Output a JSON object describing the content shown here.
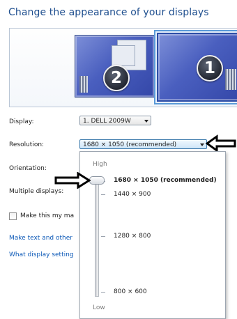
{
  "title": "Change the appearance of your displays",
  "monitors": [
    {
      "number": "2"
    },
    {
      "number": "1"
    }
  ],
  "form": {
    "display_label": "Display:",
    "display_value": "1. DELL 2009W",
    "resolution_label": "Resolution:",
    "resolution_value": "1680 × 1050 (recommended)",
    "orientation_label": "Orientation:",
    "multiple_label": "Multiple displays:",
    "make_main_label": "Make this my ma",
    "link_text": "Make text and other",
    "link_settings": "What display setting"
  },
  "dropdown": {
    "high_label": "High",
    "low_label": "Low",
    "options": [
      "1680 × 1050 (recommended)",
      "1440 × 900",
      "1280 × 800",
      "800 × 600"
    ],
    "selected_index": 0
  }
}
